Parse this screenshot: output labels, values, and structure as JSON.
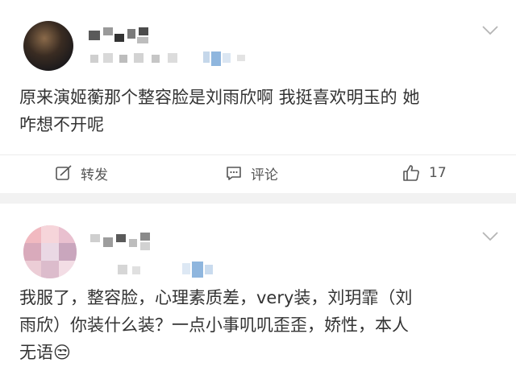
{
  "posts": [
    {
      "text_lines": [
        "原来演姬蘅那个整容脸是刘雨欣啊 我挺喜欢明玉的 她",
        "咋想不开呢"
      ],
      "actions": {
        "repost_label": "转发",
        "comment_label": "评论",
        "like_count": "17"
      }
    },
    {
      "text_lines": [
        "我服了，整容脸，心理素质差，very装，刘玥霏（刘",
        "雨欣）你装什么装？一点小事叽叽歪歪，娇性，本人",
        "无语😒"
      ]
    }
  ],
  "icons": {
    "chevron": "chevron-down-icon",
    "repost": "repost-icon",
    "comment": "comment-icon",
    "like": "thumbs-up-icon"
  },
  "colors": {
    "page_bg": "#f2f2f2",
    "card_bg": "#ffffff",
    "text": "#333333",
    "icon": "#555555",
    "blur_accent": "#8fb6de"
  }
}
